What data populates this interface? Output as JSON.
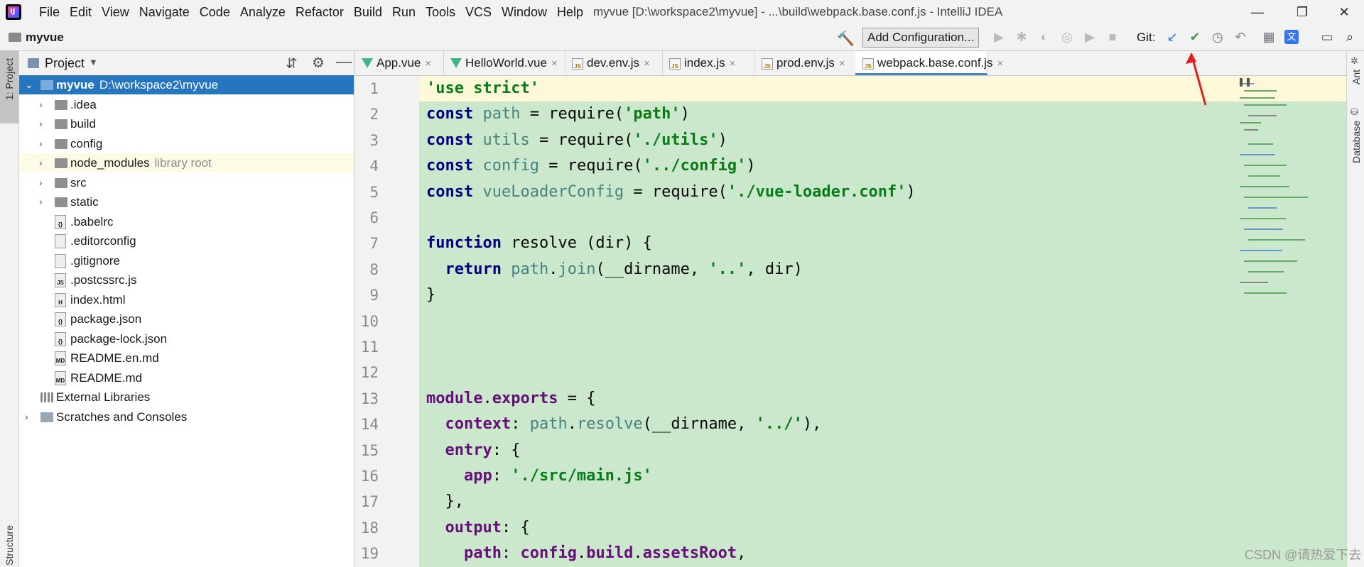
{
  "window": {
    "title": "myvue [D:\\workspace2\\myvue] - ...\\build\\webpack.base.conf.js - IntelliJ IDEA",
    "minimize": "—",
    "restore": "❐",
    "close": "✕"
  },
  "menu": [
    "File",
    "Edit",
    "View",
    "Navigate",
    "Code",
    "Analyze",
    "Refactor",
    "Build",
    "Run",
    "Tools",
    "VCS",
    "Window",
    "Help"
  ],
  "navbar": {
    "project": "myvue",
    "add_configuration": "Add Configuration...",
    "git_label": "Git:"
  },
  "left_stripe": {
    "project": "1: Project",
    "structure": "Structure"
  },
  "right_stripe": {
    "ant": "Ant",
    "database": "Database"
  },
  "project_panel": {
    "title": "Project",
    "tree": [
      {
        "label": "myvue",
        "hint": "D:\\workspace2\\myvue",
        "type": "folder",
        "expanded": true
      },
      {
        "label": ".idea",
        "type": "folder"
      },
      {
        "label": "build",
        "type": "folder"
      },
      {
        "label": "config",
        "type": "folder"
      },
      {
        "label": "node_modules",
        "hint": "library root",
        "type": "folder"
      },
      {
        "label": "src",
        "type": "folder"
      },
      {
        "label": "static",
        "type": "folder"
      },
      {
        "label": ".babelrc",
        "type": "file"
      },
      {
        "label": ".editorconfig",
        "type": "file"
      },
      {
        "label": ".gitignore",
        "type": "file"
      },
      {
        "label": ".postcssrc.js",
        "type": "file"
      },
      {
        "label": "index.html",
        "type": "file"
      },
      {
        "label": "package.json",
        "type": "file"
      },
      {
        "label": "package-lock.json",
        "type": "file"
      },
      {
        "label": "README.en.md",
        "type": "file"
      },
      {
        "label": "README.md",
        "type": "file"
      },
      {
        "label": "External Libraries",
        "type": "lib"
      },
      {
        "label": "Scratches and Consoles",
        "type": "scratch"
      }
    ]
  },
  "tabs": [
    {
      "label": "App.vue",
      "icon": "vue"
    },
    {
      "label": "HelloWorld.vue",
      "icon": "vue"
    },
    {
      "label": "dev.env.js",
      "icon": "js"
    },
    {
      "label": "index.js",
      "icon": "js"
    },
    {
      "label": "prod.env.js",
      "icon": "js"
    },
    {
      "label": "webpack.base.conf.js",
      "icon": "js",
      "active": true
    }
  ],
  "tab_close": "×",
  "file_icon_text": {
    "js": "JS",
    "md": "MD",
    "html": "H",
    "json": "{}"
  },
  "code": {
    "line_numbers": [
      "1",
      "2",
      "3",
      "4",
      "5",
      "6",
      "7",
      "8",
      "9",
      "10",
      "11",
      "12",
      "13",
      "14",
      "15",
      "16",
      "17",
      "18",
      "19"
    ],
    "lines": [
      [
        [
          "str",
          "'use strict'"
        ]
      ],
      [
        [
          "kw",
          "const "
        ],
        [
          "var",
          "path"
        ],
        [
          "plain",
          " = require("
        ],
        [
          "str",
          "'path'"
        ],
        [
          "plain",
          ")"
        ]
      ],
      [
        [
          "kw",
          "const "
        ],
        [
          "var",
          "utils"
        ],
        [
          "plain",
          " = require("
        ],
        [
          "str",
          "'./utils'"
        ],
        [
          "plain",
          ")"
        ]
      ],
      [
        [
          "kw",
          "const "
        ],
        [
          "var",
          "config"
        ],
        [
          "plain",
          " = require("
        ],
        [
          "str",
          "'../config'"
        ],
        [
          "plain",
          ")"
        ]
      ],
      [
        [
          "kw",
          "const "
        ],
        [
          "var",
          "vueLoaderConfig"
        ],
        [
          "plain",
          " = require("
        ],
        [
          "str",
          "'./vue-loader.conf'"
        ],
        [
          "plain",
          ")"
        ]
      ],
      [],
      [
        [
          "kw",
          "function "
        ],
        [
          "plain",
          "resolve (dir) {"
        ]
      ],
      [
        [
          "kw",
          "  return "
        ],
        [
          "var",
          "path"
        ],
        [
          "plain",
          "."
        ],
        [
          "var",
          "join"
        ],
        [
          "plain",
          "(__dirname, "
        ],
        [
          "str",
          "'..'"
        ],
        [
          "plain",
          ", dir)"
        ]
      ],
      [
        [
          "plain",
          "}"
        ]
      ],
      [],
      [],
      [],
      [
        [
          "prop",
          "module"
        ],
        [
          "plain",
          "."
        ],
        [
          "prop",
          "exports"
        ],
        [
          "plain",
          " = {"
        ]
      ],
      [
        [
          "prop",
          "  context"
        ],
        [
          "plain",
          ": "
        ],
        [
          "var",
          "path"
        ],
        [
          "plain",
          "."
        ],
        [
          "var",
          "resolve"
        ],
        [
          "plain",
          "(__dirname, "
        ],
        [
          "str",
          "'../'"
        ],
        [
          "plain",
          "),"
        ]
      ],
      [
        [
          "prop",
          "  entry"
        ],
        [
          "plain",
          ": {"
        ]
      ],
      [
        [
          "prop",
          "    app"
        ],
        [
          "plain",
          ": "
        ],
        [
          "str",
          "'./src/main.js'"
        ]
      ],
      [
        [
          "plain",
          "  },"
        ]
      ],
      [
        [
          "prop",
          "  output"
        ],
        [
          "plain",
          ": {"
        ]
      ],
      [
        [
          "prop",
          "    path"
        ],
        [
          "plain",
          ": "
        ],
        [
          "prop",
          "config"
        ],
        [
          "plain",
          "."
        ],
        [
          "prop",
          "build"
        ],
        [
          "plain",
          "."
        ],
        [
          "prop",
          "assetsRoot"
        ],
        [
          "plain",
          ","
        ]
      ]
    ]
  },
  "watermark": "CSDN @请热爱下去"
}
